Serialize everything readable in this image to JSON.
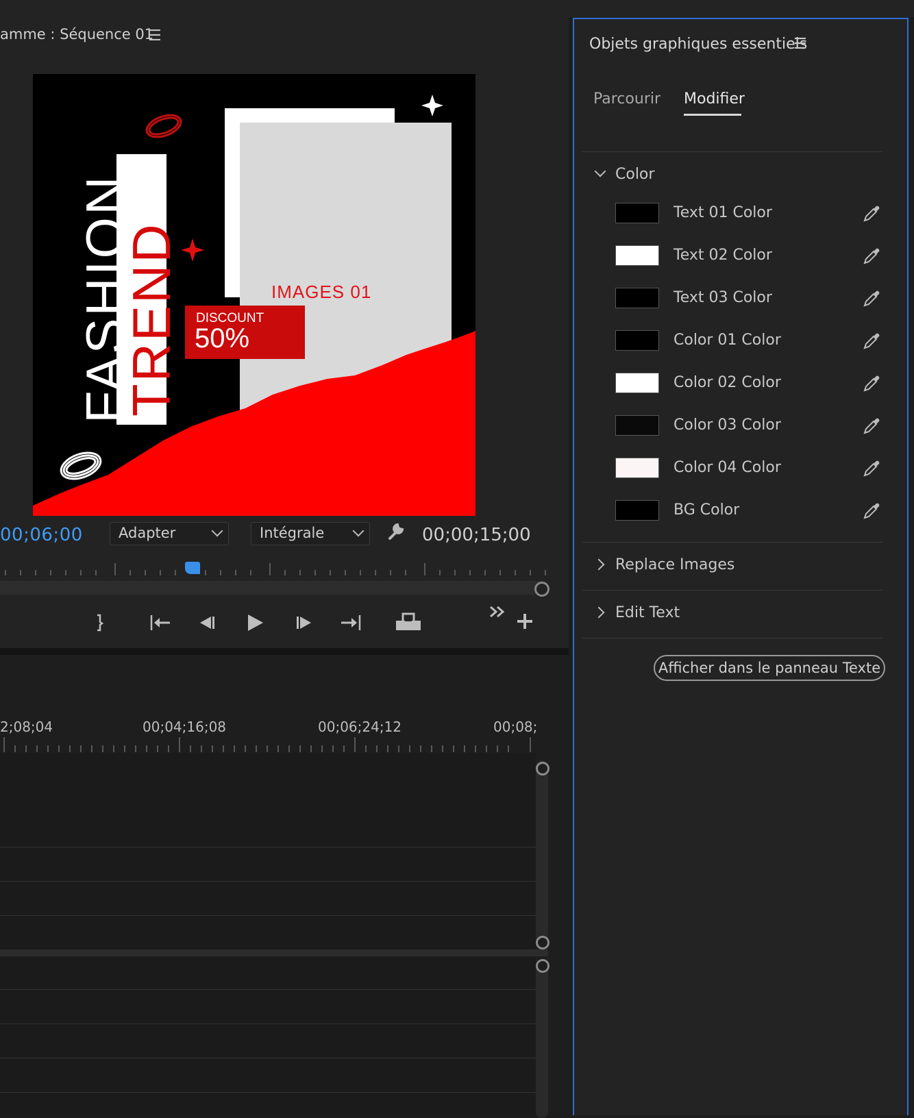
{
  "program_monitor": {
    "title": "amme : Séquence 01",
    "menu_icon": "☰",
    "current_timecode": "00;06;00",
    "zoom_dropdown": "Adapter",
    "quality_dropdown": "Intégrale",
    "duration_timecode": "00;00;15;00",
    "preview": {
      "word1": "FASHION",
      "word2": "TREND",
      "images_label": "IMAGES 01",
      "discount_label": "DISCOUNT",
      "discount_value": "50%",
      "colors": {
        "background": "#000000",
        "red": "#ff0000",
        "image_placeholder": "#d9d9d9",
        "frame": "#ffffff"
      }
    },
    "transport_icons": [
      "mark-out-icon",
      "go-to-in-icon",
      "step-back-icon",
      "play-icon",
      "step-forward-icon",
      "go-to-out-icon",
      "export-frame-icon",
      "more-icon",
      "add-button-icon"
    ]
  },
  "timeline": {
    "ruler_labels": [
      "2;08;04",
      "00;04;16;08",
      "00;06;24;12",
      "00;08;"
    ]
  },
  "essential_graphics": {
    "title": "Objets graphiques essentiels",
    "menu_icon": "☰",
    "tabs": [
      {
        "label": "Parcourir",
        "active": false
      },
      {
        "label": "Modifier",
        "active": true
      }
    ],
    "color_section": {
      "label": "Color",
      "expanded": true,
      "items": [
        {
          "label": "Text 01 Color",
          "color": "#000000"
        },
        {
          "label": "Text 02 Color",
          "color": "#ffffff"
        },
        {
          "label": "Text 03 Color",
          "color": "#000000"
        },
        {
          "label": "Color 01 Color",
          "color": "#000000"
        },
        {
          "label": "Color 02 Color",
          "color": "#ffffff"
        },
        {
          "label": "Color 03 Color",
          "color": "#0a0a0a"
        },
        {
          "label": "Color 04 Color",
          "color": "#fbf5f5"
        },
        {
          "label": "BG Color",
          "color": "#000000"
        }
      ]
    },
    "replace_images": {
      "label": "Replace Images",
      "expanded": false
    },
    "edit_text": {
      "label": "Edit Text",
      "expanded": false
    },
    "show_in_text_panel_button": "Afficher dans le panneau Texte"
  },
  "colors": {
    "panel_bg": "#232323",
    "accent_blue": "#3f9cf4",
    "focus_border": "#2e6fd0"
  }
}
